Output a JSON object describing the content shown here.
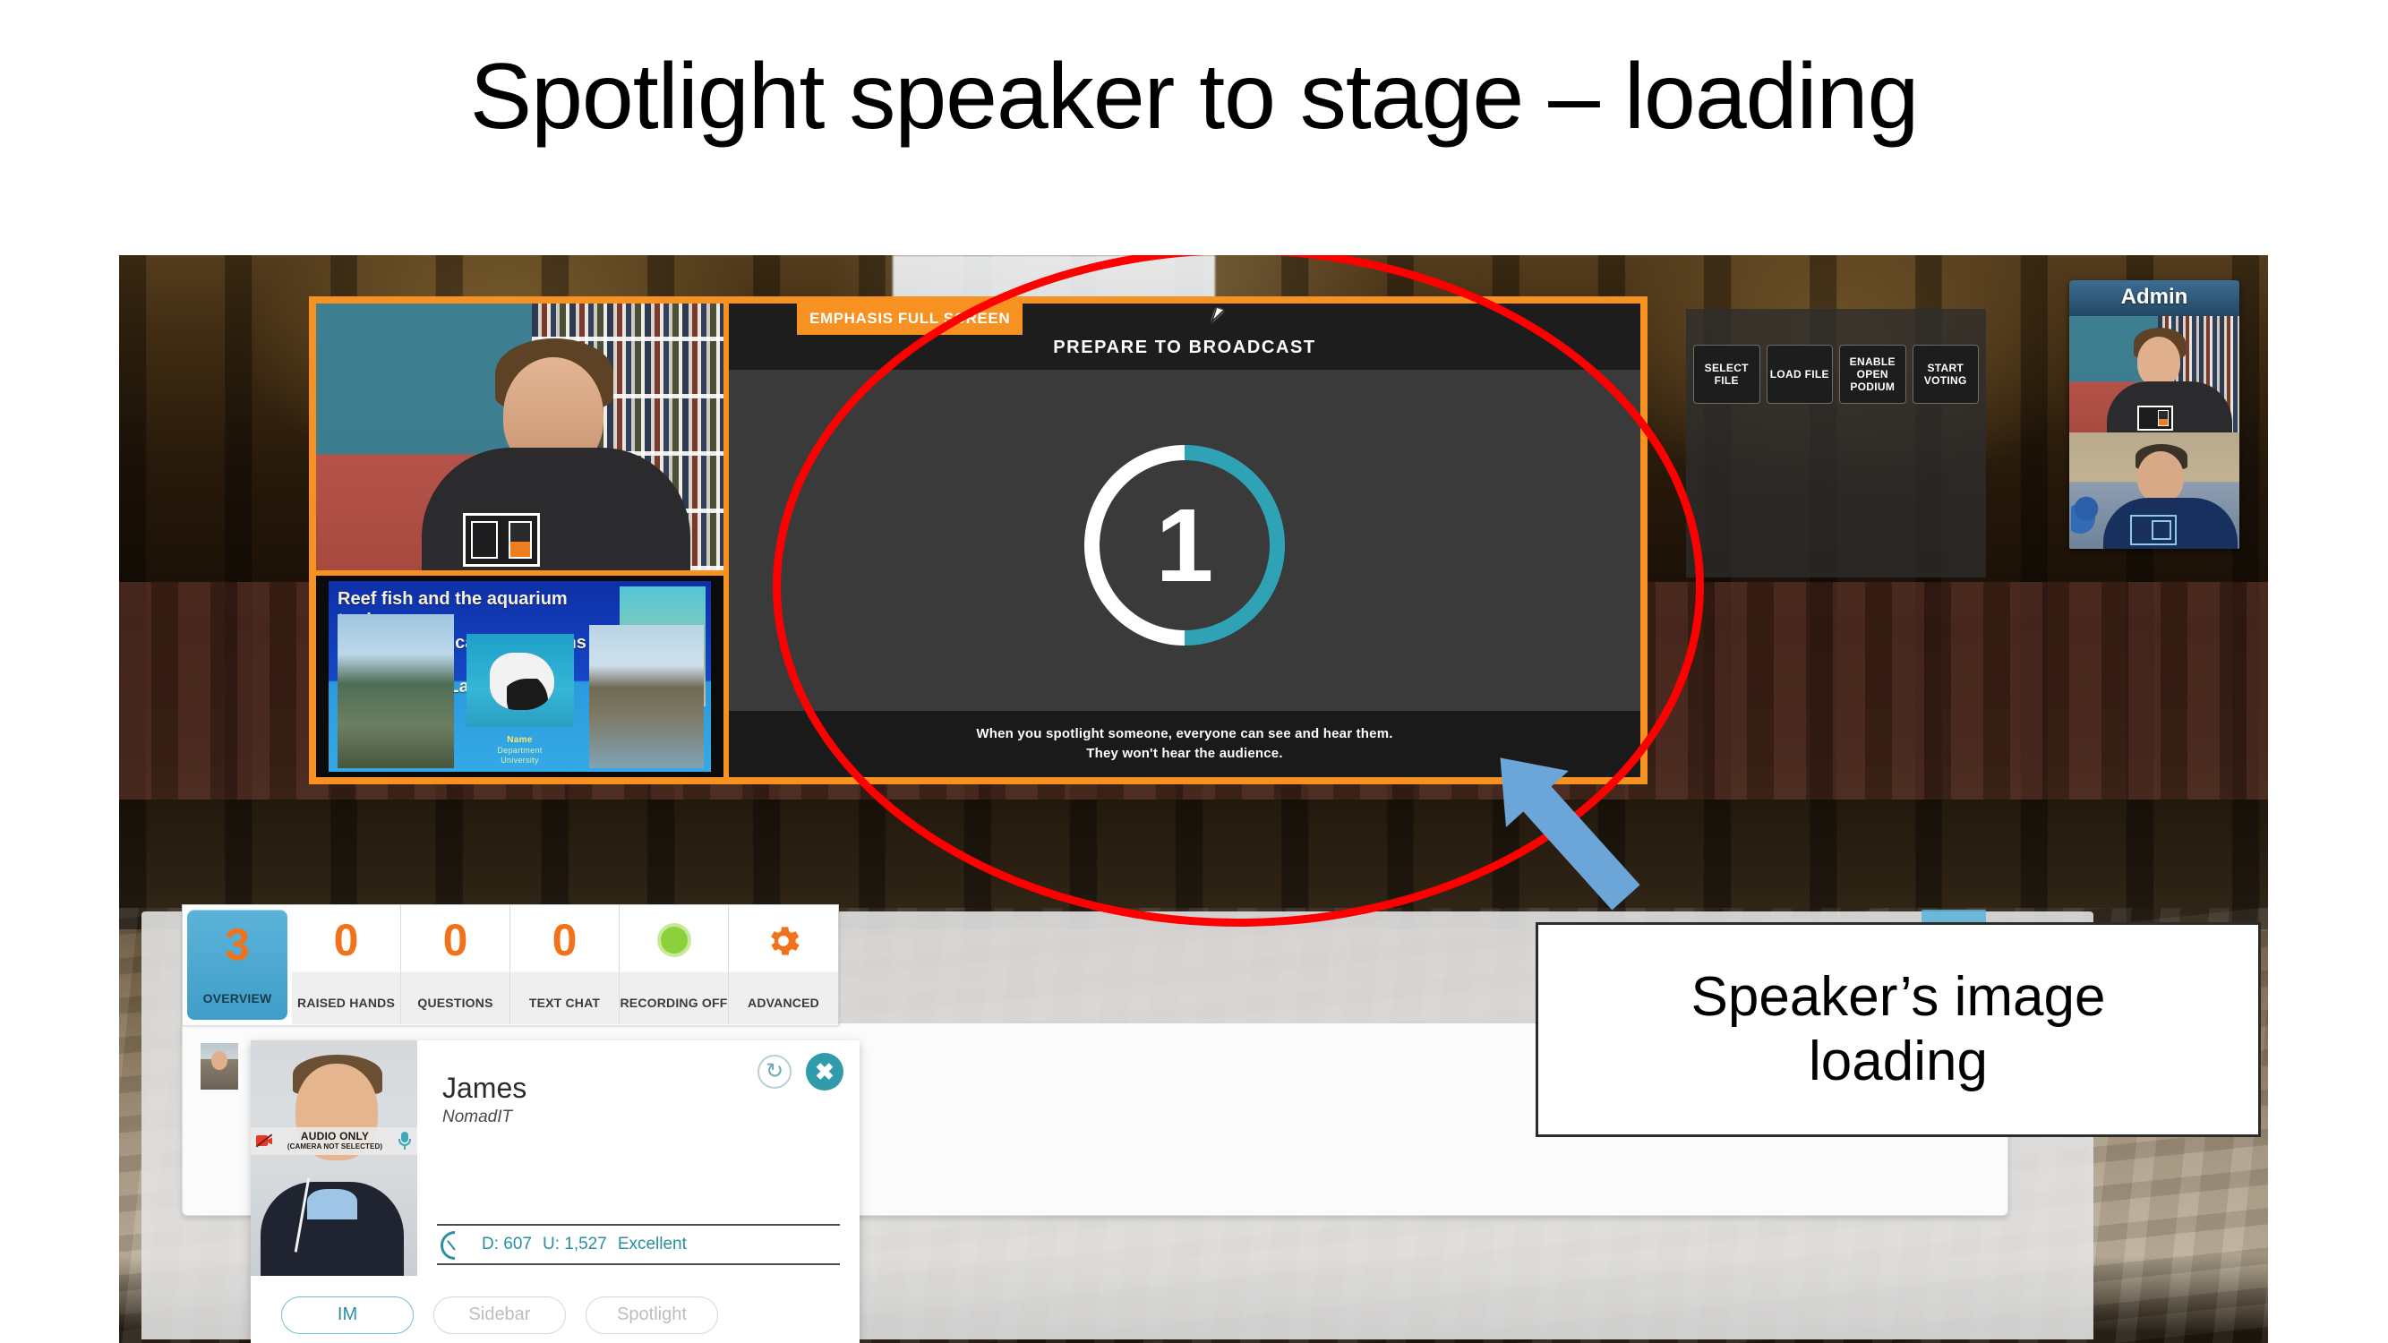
{
  "slide": {
    "title": "Spotlight speaker to stage – loading"
  },
  "stage": {
    "emphasis_badge": "EMPHASIS FULL SCREEN",
    "prepare_text": "PREPARE TO BROADCAST",
    "countdown_number": "1",
    "countdown_progress_percent": 50,
    "footer_line1": "When you spotlight someone, everyone can see and hear them.",
    "footer_line2": "They won't hear the audience.",
    "accent_orange": "#f79122",
    "accent_teal": "#2fa3b5"
  },
  "presentation_slide": {
    "title_line1": "Reef fish and the aquarium trade:",
    "title_line2": "Socio-ecological interactions in",
    "title_line3": "southern Sri Lanka",
    "credit_name": "Name",
    "credit_department": "Department",
    "credit_university": "University"
  },
  "right_tools": {
    "buttons": [
      {
        "label": "SELECT\nFILE",
        "name": "select-file-button"
      },
      {
        "label": "LOAD\nFILE",
        "name": "load-file-button"
      },
      {
        "label": "ENABLE\nOPEN\nPODIUM",
        "name": "enable-open-podium-button"
      },
      {
        "label": "START\nVOTING",
        "name": "start-voting-button"
      }
    ],
    "button_labels": {
      "select_file": "SELECT FILE",
      "load_file": "LOAD FILE",
      "enable_open_podium": "ENABLE OPEN PODIUM",
      "start_voting": "START VOTING"
    }
  },
  "admin_panel": {
    "title": "Admin"
  },
  "toolbar": {
    "tabs": [
      {
        "value": "3",
        "label": "OVERVIEW",
        "active": true
      },
      {
        "value": "0",
        "label": "RAISED HANDS",
        "active": false
      },
      {
        "value": "0",
        "label": "QUESTIONS",
        "active": false
      },
      {
        "value": "0",
        "label": "TEXT CHAT",
        "active": false
      },
      {
        "value": "",
        "label": "RECORDING OFF",
        "active": false
      },
      {
        "value": "",
        "label": "ADVANCED",
        "active": false
      }
    ],
    "accent_blue": "#4ba7d1",
    "accent_orange": "#f2721b",
    "recording_green": "#8cd03b"
  },
  "participant_card": {
    "name": "James",
    "organisation": "NomadIT",
    "video_overlay_line1": "AUDIO ONLY",
    "video_overlay_line2": "(CAMERA NOT SELECTED)",
    "stats_down_label": "D: 607",
    "stats_up_label": "U: 1,527",
    "stats_quality": "Excellent",
    "buttons": {
      "im": "IM",
      "sidebar": "Sidebar",
      "spotlight": "Spotlight"
    },
    "refresh_glyph": "↻",
    "close_glyph": "✖"
  },
  "annotation": {
    "callout_line1": "Speaker’s image",
    "callout_line2": "loading",
    "ellipse_color": "#ff0000",
    "arrow_color": "#6ca5d8"
  }
}
